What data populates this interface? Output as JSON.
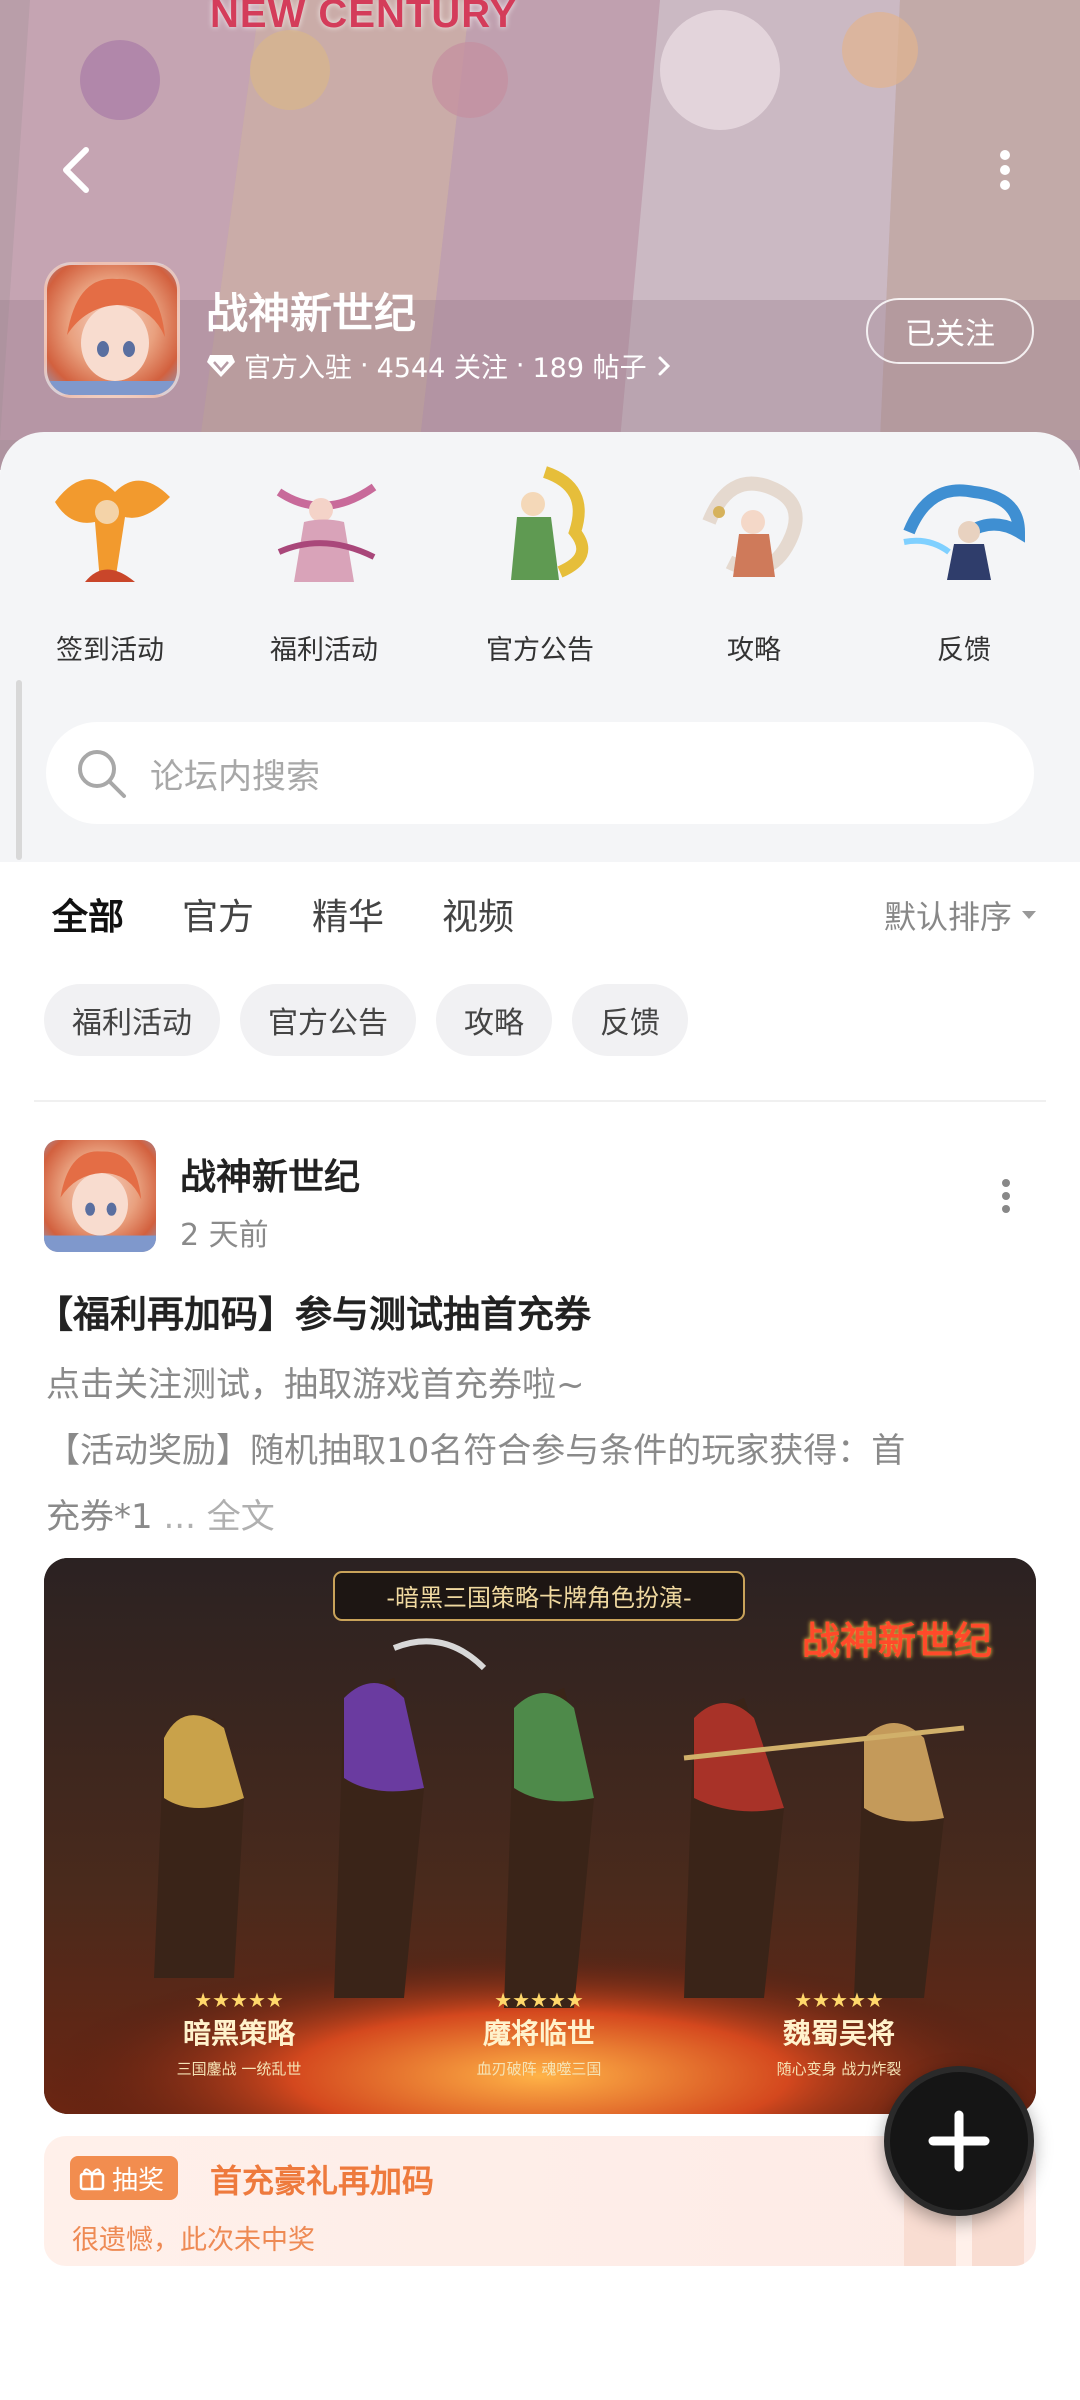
{
  "banner": {
    "art_title": "NEW CENTURY",
    "app_name": "战神新世纪",
    "official_badge": "官方入驻",
    "followers": "4544 关注",
    "posts": "189 帖子",
    "separator": "·",
    "follow_label": "已关注"
  },
  "quick_entries": [
    {
      "label": "签到活动",
      "icon": "phoenix-warrior-icon"
    },
    {
      "label": "福利活动",
      "icon": "dancer-character-icon"
    },
    {
      "label": "官方公告",
      "icon": "dragon-general-icon"
    },
    {
      "label": "攻略",
      "icon": "white-dragon-icon"
    },
    {
      "label": "反馈",
      "icon": "blue-dragon-icon"
    }
  ],
  "search": {
    "placeholder": "论坛内搜索"
  },
  "tabs": [
    {
      "label": "全部",
      "active": true
    },
    {
      "label": "官方",
      "active": false
    },
    {
      "label": "精华",
      "active": false
    },
    {
      "label": "视频",
      "active": false
    }
  ],
  "sort": {
    "label": "默认排序"
  },
  "chips": [
    "福利活动",
    "官方公告",
    "攻略",
    "反馈"
  ],
  "post": {
    "author": "战神新世纪",
    "time": "2 天前",
    "title": "【福利再加码】参与测试抽首充券",
    "body_line1": "点击关注测试，抽取游戏首充券啦~",
    "body_line2": "【活动奖励】随机抽取10名符合参与条件的玩家获得：首",
    "body_line3": "充券*1",
    "ellipsis": "...",
    "full_text": "全文",
    "image": {
      "banner_text": "-暗黑三国策略卡牌角色扮演-",
      "logo_text": "战神新世纪",
      "badges": [
        {
          "title": "暗黑策略",
          "sub": "三国鏖战 一统乱世"
        },
        {
          "title": "魔将临世",
          "sub": "血刃破阵 魂噬三国"
        },
        {
          "title": "魏蜀吴将",
          "sub": "随心变身 战力炸裂"
        }
      ]
    }
  },
  "lottery": {
    "badge": "抽奖",
    "title": "首充豪礼再加码",
    "status": "很遗憾，此次未中奖"
  },
  "colors": {
    "accent": "#2fd4b2",
    "lottery_orange": "#ee7a3d"
  }
}
